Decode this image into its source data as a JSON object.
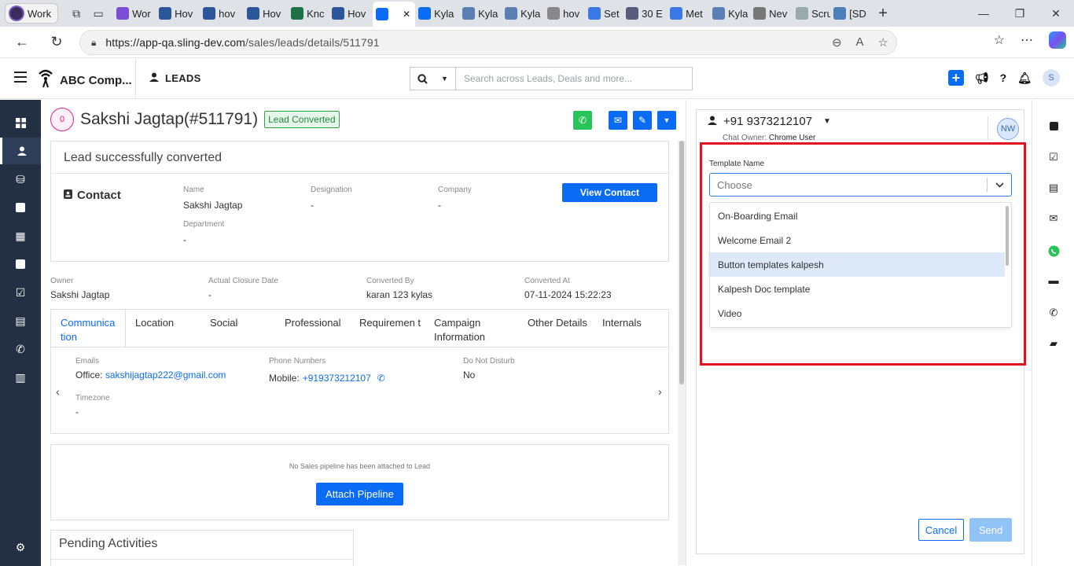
{
  "browser": {
    "profile_label": "Work",
    "tabs": [
      {
        "label": "Wor",
        "color": "#7a4fd6"
      },
      {
        "label": "Hov",
        "color": "#2b579a"
      },
      {
        "label": "hov",
        "color": "#2b579a"
      },
      {
        "label": "Hov",
        "color": "#2b579a"
      },
      {
        "label": "Knc",
        "color": "#1e7145"
      },
      {
        "label": "Hov",
        "color": "#2b579a"
      },
      {
        "label": "",
        "color": "#0a6cf5",
        "active": true
      },
      {
        "label": "Kyla",
        "color": "#0a6cf5"
      },
      {
        "label": "Kyla",
        "color": "#5a7fb5"
      },
      {
        "label": "Kyla",
        "color": "#5a7fb5"
      },
      {
        "label": "hov",
        "color": "#888888"
      },
      {
        "label": "Set",
        "color": "#3b78e7"
      },
      {
        "label": "30 E",
        "color": "#5a5a7a"
      },
      {
        "label": "Met",
        "color": "#3b78e7"
      },
      {
        "label": "Kyla",
        "color": "#5a7fb5"
      },
      {
        "label": "Nev",
        "color": "#777777"
      },
      {
        "label": "Scru",
        "color": "#9aa"
      },
      {
        "label": "[SD",
        "color": "#4a7fb8"
      }
    ],
    "url_host": "https://app-qa.sling-dev.com",
    "url_path": "/sales/leads/details/511791"
  },
  "header": {
    "company": "ABC Comp...",
    "module": "LEADS",
    "search_placeholder": "Search across Leads, Deals and more...",
    "user_initial": "S"
  },
  "lead": {
    "score": "0",
    "name": "Sakshi Jagtap(#511791)",
    "status_badge": "Lead Converted",
    "success_message": "Lead successfully converted",
    "contact_heading": "Contact",
    "contact": {
      "name_label": "Name",
      "name_value": "Sakshi Jagtap",
      "designation_label": "Designation",
      "designation_value": "-",
      "company_label": "Company",
      "company_value": "-",
      "department_label": "Department",
      "department_value": "-"
    },
    "view_contact_label": "View Contact",
    "meta": [
      {
        "label": "Owner",
        "value": "Sakshi Jagtap"
      },
      {
        "label": "Actual Closure Date",
        "value": "-"
      },
      {
        "label": "Converted By",
        "value": "karan 123 kylas"
      },
      {
        "label": "Converted At",
        "value": "07-11-2024 15:22:23"
      }
    ],
    "tabs": [
      {
        "label": "Communica tion",
        "active": true
      },
      {
        "label": "Location"
      },
      {
        "label": "Social"
      },
      {
        "label": "Professional"
      },
      {
        "label": "Requiremen t"
      },
      {
        "label": "Campaign Information"
      },
      {
        "label": "Other Details"
      },
      {
        "label": "Internals"
      }
    ],
    "communication": {
      "emails_label": "Emails",
      "email_prefix": "Office:",
      "email_value": "sakshijagtap222@gmail.com",
      "phones_label": "Phone Numbers",
      "phone_prefix": "Mobile:",
      "phone_value": "+919373212107",
      "dnd_label": "Do Not Disturb",
      "dnd_value": "No",
      "timezone_label": "Timezone",
      "timezone_value": "-"
    },
    "pipeline_message": "No Sales pipeline has been attached to Lead",
    "attach_pipeline_label": "Attach Pipeline",
    "pending_activities": "Pending Activities"
  },
  "chat": {
    "phone": "+91 9373212107",
    "owner_label": "Chat Owner:",
    "owner_value": "Chrome User",
    "owner_initials": "NW",
    "template_label": "Template Name",
    "template_placeholder": "Choose",
    "template_options": [
      "On-Boarding Email",
      "Welcome Email 2",
      "Button templates kalpesh",
      "Kalpesh Doc template",
      "Video"
    ],
    "highlighted_option_index": 2,
    "cancel_label": "Cancel",
    "send_label": "Send"
  }
}
